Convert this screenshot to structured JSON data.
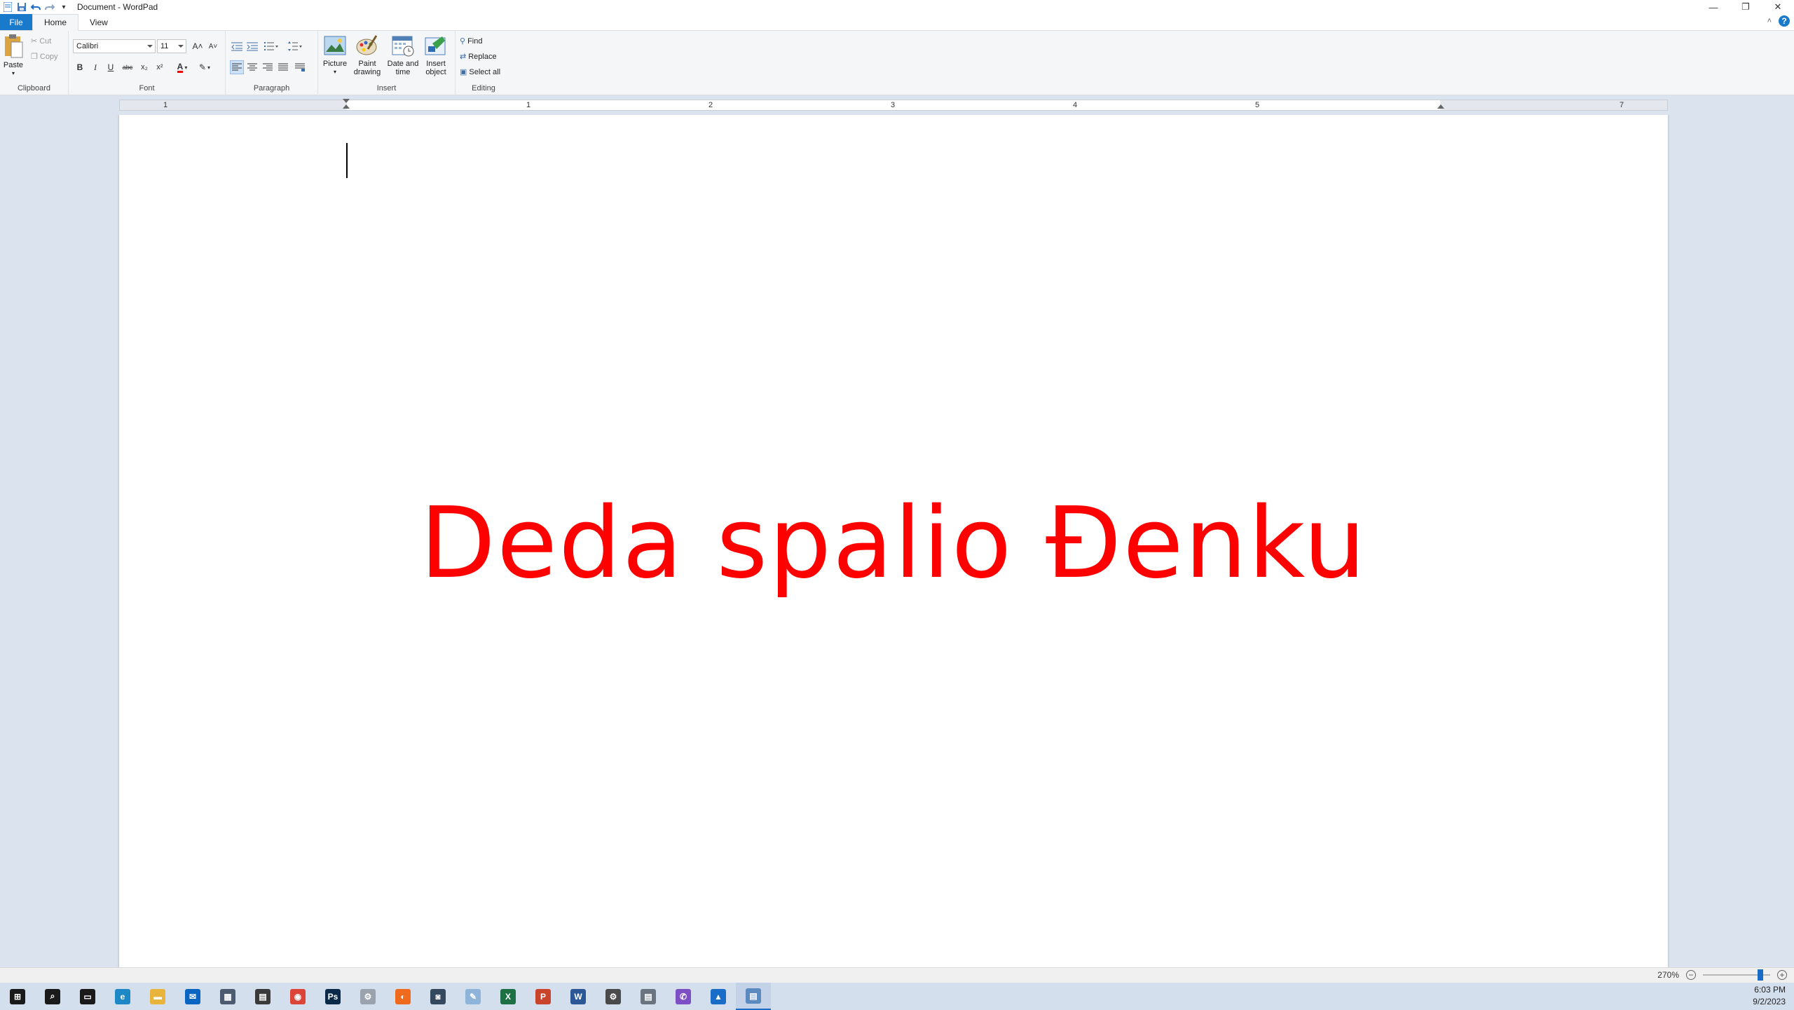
{
  "window": {
    "title": "Document - WordPad",
    "minimize": "—",
    "restore": "❐",
    "close": "✕"
  },
  "tabs": [
    {
      "label": "File"
    },
    {
      "label": "Home"
    },
    {
      "label": "View"
    }
  ],
  "ribbon": {
    "clipboard": {
      "label": "Clipboard",
      "paste": "Paste",
      "cut": "Cut",
      "copy": "Copy"
    },
    "font": {
      "label": "Font",
      "family": "Calibri",
      "size": "11",
      "bold": "B",
      "italic": "I",
      "underline": "U",
      "strike": "abc",
      "subscript": "x₂",
      "superscript": "x²",
      "grow": "A˄",
      "shrink": "A˅",
      "color_glyph": "A",
      "color": "#ff0000"
    },
    "paragraph": {
      "label": "Paragraph"
    },
    "insert": {
      "label": "Insert",
      "picture": "Picture",
      "paint_drawing": "Paint drawing",
      "date_time": "Date and time",
      "insert_object": "Insert object"
    },
    "editing": {
      "label": "Editing",
      "find": "Find",
      "replace": "Replace",
      "select_all": "Select all"
    }
  },
  "ruler": {
    "numbers": [
      "1",
      "1",
      "2",
      "3",
      "4",
      "5",
      "7"
    ]
  },
  "document": {
    "text": "Deda spalio Đenku",
    "text_color": "#ff0000"
  },
  "statusbar": {
    "zoom": "270%",
    "zoom_out": "−",
    "zoom_in": "+",
    "zoom_level": 0.85
  },
  "taskbar": {
    "items": [
      {
        "name": "start",
        "glyph": "⊞",
        "color": "#1a1a1a"
      },
      {
        "name": "search",
        "glyph": "⌕",
        "color": "#1a1a1a"
      },
      {
        "name": "task-view",
        "glyph": "▭",
        "color": "#1a1a1a"
      },
      {
        "name": "edge",
        "glyph": "e",
        "color": "#1e88c7"
      },
      {
        "name": "file-explorer",
        "glyph": "▬",
        "color": "#e8b43c"
      },
      {
        "name": "mail",
        "glyph": "✉",
        "color": "#0a64c2"
      },
      {
        "name": "calculator",
        "glyph": "▦",
        "color": "#4c5b70"
      },
      {
        "name": "clipchamp",
        "glyph": "▤",
        "color": "#3a3a3a"
      },
      {
        "name": "chrome",
        "glyph": "◉",
        "color": "#db4437"
      },
      {
        "name": "photoshop",
        "glyph": "Ps",
        "color": "#0b2a4a"
      },
      {
        "name": "app-gray",
        "glyph": "⚙",
        "color": "#9aa3ad"
      },
      {
        "name": "firefox",
        "glyph": "◐",
        "color": "#f06a1d"
      },
      {
        "name": "camera-app",
        "glyph": "◙",
        "color": "#34485e"
      },
      {
        "name": "paint",
        "glyph": "✎",
        "color": "#8fb4d9"
      },
      {
        "name": "excel",
        "glyph": "X",
        "color": "#1d7044"
      },
      {
        "name": "powerpoint",
        "glyph": "P",
        "color": "#c9442b"
      },
      {
        "name": "word",
        "glyph": "W",
        "color": "#2b5797"
      },
      {
        "name": "settings",
        "glyph": "⚙",
        "color": "#4a4a4a"
      },
      {
        "name": "printer",
        "glyph": "▤",
        "color": "#6a7480"
      },
      {
        "name": "viber",
        "glyph": "✆",
        "color": "#7d4fc4"
      },
      {
        "name": "photos",
        "glyph": "▲",
        "color": "#1a6dc7"
      },
      {
        "name": "wordpad",
        "glyph": "▤",
        "color": "#5a8ac0"
      }
    ],
    "active_index": 21,
    "time": "6:03 PM",
    "date": "9/2/2023"
  }
}
